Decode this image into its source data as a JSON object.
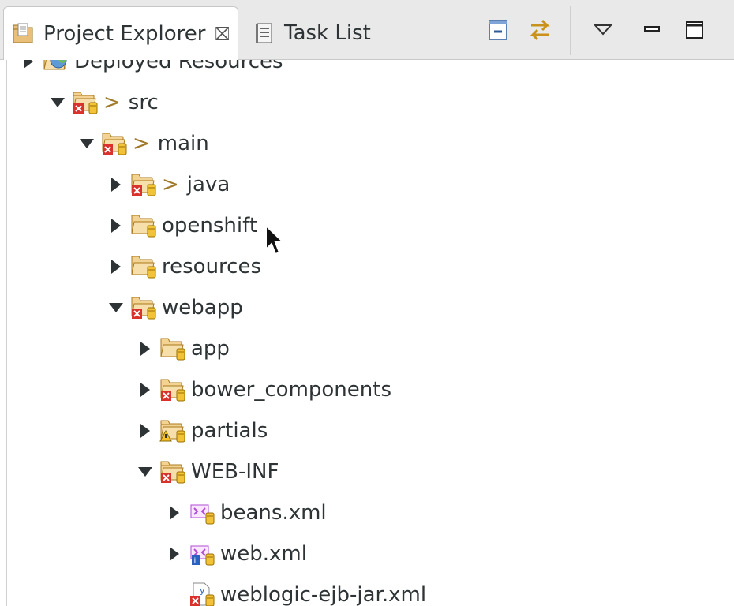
{
  "tabs": [
    {
      "label": "Project Explorer",
      "icon": "project-explorer-icon",
      "active": true
    },
    {
      "label": "Task List",
      "icon": "task-list-icon",
      "active": false
    }
  ],
  "toolbar": {
    "collapse_all": "collapse-all-icon",
    "link_with_editor": "link-with-editor-icon",
    "view_menu": "view-menu-icon",
    "minimize": "minimize-icon",
    "maximize": "maximize-icon"
  },
  "tree": [
    {
      "label": "Deployed Resources",
      "prefix": "",
      "expanded": false,
      "icon": "deployed-resources-icon",
      "level": 0
    },
    {
      "label": "src",
      "prefix": ">",
      "expanded": true,
      "icon": "folder-error-icon",
      "level": 1
    },
    {
      "label": "main",
      "prefix": ">",
      "expanded": true,
      "icon": "folder-error-icon",
      "level": 2
    },
    {
      "label": "java",
      "prefix": ">",
      "expanded": false,
      "icon": "folder-error-icon",
      "level": 3
    },
    {
      "label": "openshift",
      "prefix": "",
      "expanded": false,
      "icon": "folder-icon",
      "level": 3
    },
    {
      "label": "resources",
      "prefix": "",
      "expanded": false,
      "icon": "folder-icon",
      "level": 3
    },
    {
      "label": "webapp",
      "prefix": "",
      "expanded": true,
      "icon": "folder-error-icon",
      "level": 3
    },
    {
      "label": "app",
      "prefix": "",
      "expanded": false,
      "icon": "folder-icon",
      "level": 4
    },
    {
      "label": "bower_components",
      "prefix": "",
      "expanded": false,
      "icon": "folder-error-icon",
      "level": 4
    },
    {
      "label": "partials",
      "prefix": "",
      "expanded": false,
      "icon": "folder-warning-icon",
      "level": 4
    },
    {
      "label": "WEB-INF",
      "prefix": "",
      "expanded": true,
      "icon": "folder-error-icon",
      "level": 4
    },
    {
      "label": "beans.xml",
      "prefix": "",
      "expanded": false,
      "icon": "xml-file-icon",
      "level": 5
    },
    {
      "label": "web.xml",
      "prefix": "",
      "expanded": false,
      "icon": "xml-info-file-icon",
      "level": 5
    },
    {
      "label": "weblogic-ejb-jar.xml",
      "prefix": "",
      "expanded": null,
      "icon": "xml-error-file-icon",
      "level": 5
    }
  ]
}
